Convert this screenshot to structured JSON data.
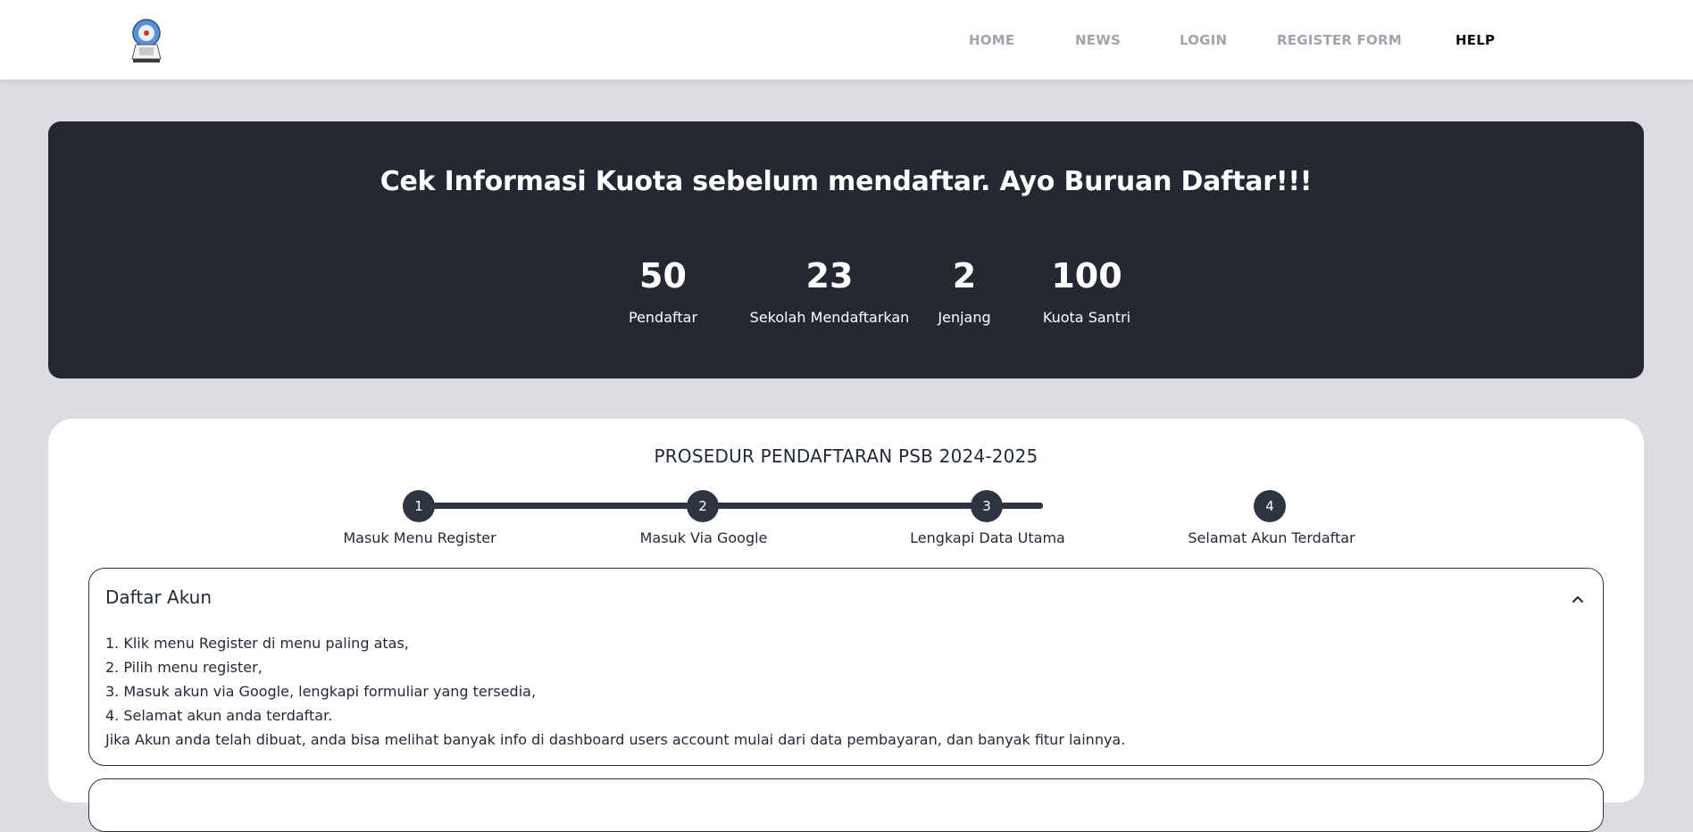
{
  "navbar": {
    "logo_icon": "school-emblem-logo",
    "links": [
      "HOME",
      "NEWS",
      "LOGIN",
      "REGISTER FORM",
      "HELP"
    ],
    "active": "HELP"
  },
  "hero": {
    "title": "Cek Informasi Kuota sebelum mendaftar. Ayo Buruan Daftar!!!",
    "stats": [
      {
        "value": "50",
        "label": "Pendaftar"
      },
      {
        "value": "23",
        "label": "Sekolah Mendaftarkan"
      },
      {
        "value": "2",
        "label": "Jenjang"
      },
      {
        "value": "100",
        "label": "Kuota Santri"
      }
    ]
  },
  "procedure": {
    "title": "PROSEDUR PENDAFTARAN PSB 2024-2025",
    "steps": [
      {
        "number": "1",
        "label": "Masuk Menu Register"
      },
      {
        "number": "2",
        "label": "Masuk Via Google"
      },
      {
        "number": "3",
        "label": "Lengkapi Data Utama"
      },
      {
        "number": "4",
        "label": "Selamat Akun Terdaftar"
      }
    ],
    "accordion": {
      "title": "Daftar Akun",
      "expanded_icon": "chevron-up-icon",
      "lines": [
        "1. Klik menu Register di menu paling atas,",
        "2. Pilih menu register,",
        "3. Masuk akun via Google, lengkapi formuliar yang tersedia,",
        "4. Selamat akun anda terdaftar.",
        "Jika Akun anda telah dibuat, anda bisa melihat banyak info di dashboard users account mulai dari data pembayaran, dan banyak fitur lainnya."
      ]
    }
  },
  "colors": {
    "page_bg": "#dcdde1",
    "hero_bg": "#232832",
    "step_color": "#2e3440",
    "nav_inactive": "#a0a4ad",
    "nav_active": "#0b0b0b"
  }
}
